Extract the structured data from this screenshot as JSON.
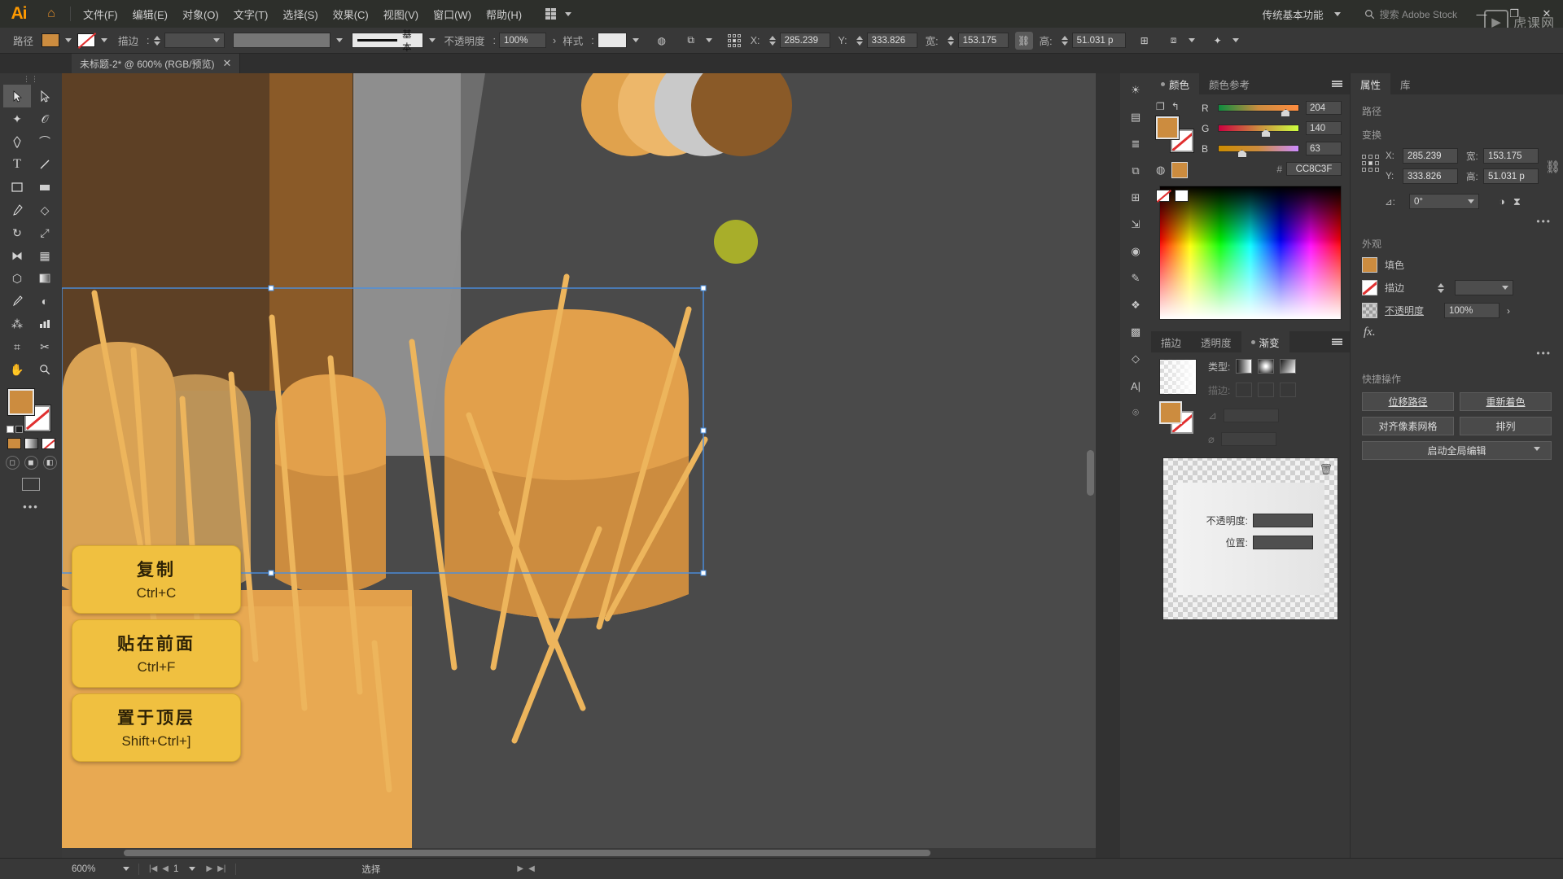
{
  "app": {
    "name": "Ai",
    "home_icon": "home-icon"
  },
  "menubar": {
    "items": [
      "文件(F)",
      "编辑(E)",
      "对象(O)",
      "文字(T)",
      "选择(S)",
      "效果(C)",
      "视图(V)",
      "窗口(W)",
      "帮助(H)"
    ],
    "arrange_label": "",
    "workspace": "传统基本功能",
    "search_placeholder": "搜索 Adobe Stock",
    "window_controls": [
      "—",
      "❐",
      "✕"
    ],
    "brand_text": "虎课网"
  },
  "controlbar": {
    "path_label": "路径",
    "fill_color": "#cc8c3f",
    "stroke_none": "none-swatch",
    "stroke_label": "描边",
    "stroke_weight": "",
    "stroke_profile": "",
    "brush_label": "基本",
    "opacity_label": "不透明度",
    "opacity_value": "100%",
    "style_label": "样式",
    "x_label": "X:",
    "x_value": "285.239",
    "y_label": "Y:",
    "y_value": "333.826",
    "w_label": "宽:",
    "w_value": "153.175",
    "link_icon": "link-icon",
    "h_label": "高:",
    "h_value": "51.031 p"
  },
  "document_tab": {
    "title": "未标题-2* @ 600% (RGB/预览)",
    "close": "✕"
  },
  "toolbar": {
    "grip": "⋮⋮",
    "tools": [
      "selection-tool",
      "direct-selection-tool",
      "magic-wand-tool",
      "lasso-tool",
      "pen-tool",
      "curvature-tool",
      "type-tool",
      "line-tool",
      "rectangle-tool",
      "ellipse-tool",
      "paintbrush-tool",
      "shaper-tool",
      "rotate-tool",
      "scale-tool",
      "width-tool",
      "free-transform-tool",
      "shape-builder-tool",
      "gradient-tool",
      "eyedropper-tool",
      "blend-tool",
      "symbol-sprayer-tool",
      "column-graph-tool",
      "artboard-tool",
      "slice-tool",
      "hand-tool",
      "zoom-tool"
    ],
    "fill_color": "#cc8c3f",
    "stroke_color": "#ffffff",
    "swatch_row": [
      "#cc8c3f",
      "#8a8a8a",
      "#ffffff"
    ],
    "screen_mode": "screen-mode-icon",
    "more_dots": "•••"
  },
  "hotkey_cards": [
    {
      "title": "复制",
      "key": "Ctrl+C"
    },
    {
      "title": "贴在前面",
      "key": "Ctrl+F"
    },
    {
      "title": "置于顶层",
      "key": "Shift+Ctrl+]"
    }
  ],
  "icon_rail": [
    "sun-icon",
    "libraries-icon",
    "layers-panel-icon",
    "pathfinder-icon",
    "align-icon",
    "transform-icon",
    "appearance-icon",
    "brushes-icon",
    "symbols-icon",
    "swatches-icon",
    "graphic-styles-icon",
    "character-icon",
    "paragraph-icon"
  ],
  "color_panel": {
    "tabs": [
      {
        "label": "颜色",
        "active": true
      },
      {
        "label": "颜色参考",
        "active": false
      }
    ],
    "sliders": [
      {
        "label": "R",
        "value": "204",
        "pos": 80
      },
      {
        "label": "G",
        "value": "140",
        "pos": 55
      },
      {
        "label": "B",
        "value": "63",
        "pos": 25
      }
    ],
    "hex_prefix": "#",
    "hex_value": "CC8C3F",
    "fill_color": "#cc8c3f"
  },
  "gradient_panel": {
    "tabs": [
      {
        "label": "描边",
        "active": false
      },
      {
        "label": "透明度",
        "active": false
      },
      {
        "label": "渐变",
        "active": true
      }
    ],
    "type_label": "类型:",
    "stroke_label": "描边:",
    "angle_label": "角度:",
    "opacity_label": "不透明度:",
    "position_label": "位置:",
    "opacity_value": "",
    "position_value": ""
  },
  "properties_panel": {
    "tabs": [
      {
        "label": "属性",
        "active": true
      },
      {
        "label": "库",
        "active": false
      }
    ],
    "object_type": "路径",
    "transform_title": "变换",
    "transform": {
      "x_label": "X:",
      "x_value": "285.239",
      "y_label": "Y:",
      "y_value": "333.826",
      "w_label": "宽:",
      "w_value": "153.175",
      "h_label": "高:",
      "h_value": "51.031 p",
      "angle_label": "⊿:",
      "angle_value": "0°",
      "link_icon": "unlink-icon",
      "flip_h_icon": "flip-horizontal-icon",
      "flip_v_icon": "flip-vertical-icon"
    },
    "appearance_title": "外观",
    "appearance": {
      "fill_label": "填色",
      "fill_color": "#cc8c3f",
      "stroke_label": "描边",
      "stroke_value": "",
      "opacity_label": "不透明度",
      "opacity_value": "100%",
      "fx_label": "fx."
    },
    "quick_actions_title": "快捷操作",
    "quick_actions": [
      "位移路径",
      "重新着色",
      "对齐像素网格",
      "排列",
      "启动全局编辑"
    ]
  },
  "statusbar": {
    "zoom": "600%",
    "artboard_number": "1",
    "status_text": "选择",
    "nav_first": "|◀",
    "nav_prev": "◀",
    "nav_next": "▶",
    "nav_last": "▶|",
    "play": "▶",
    "arrow": "◀"
  },
  "artwork": {
    "bg_color": "#4a4a4a",
    "colors": {
      "dark_brown": "#5e3f23",
      "mid_brown": "#7a4f25",
      "light_brown": "#8a5a28",
      "gray_pillar": "#8c8c8c",
      "orange": "#e2a04b",
      "orange_dark": "#cc8c3f",
      "orange_light": "#efb76a",
      "olive": "#a8ae2a",
      "straw": "#edb55c",
      "selection_blue": "#4a90e2"
    }
  }
}
